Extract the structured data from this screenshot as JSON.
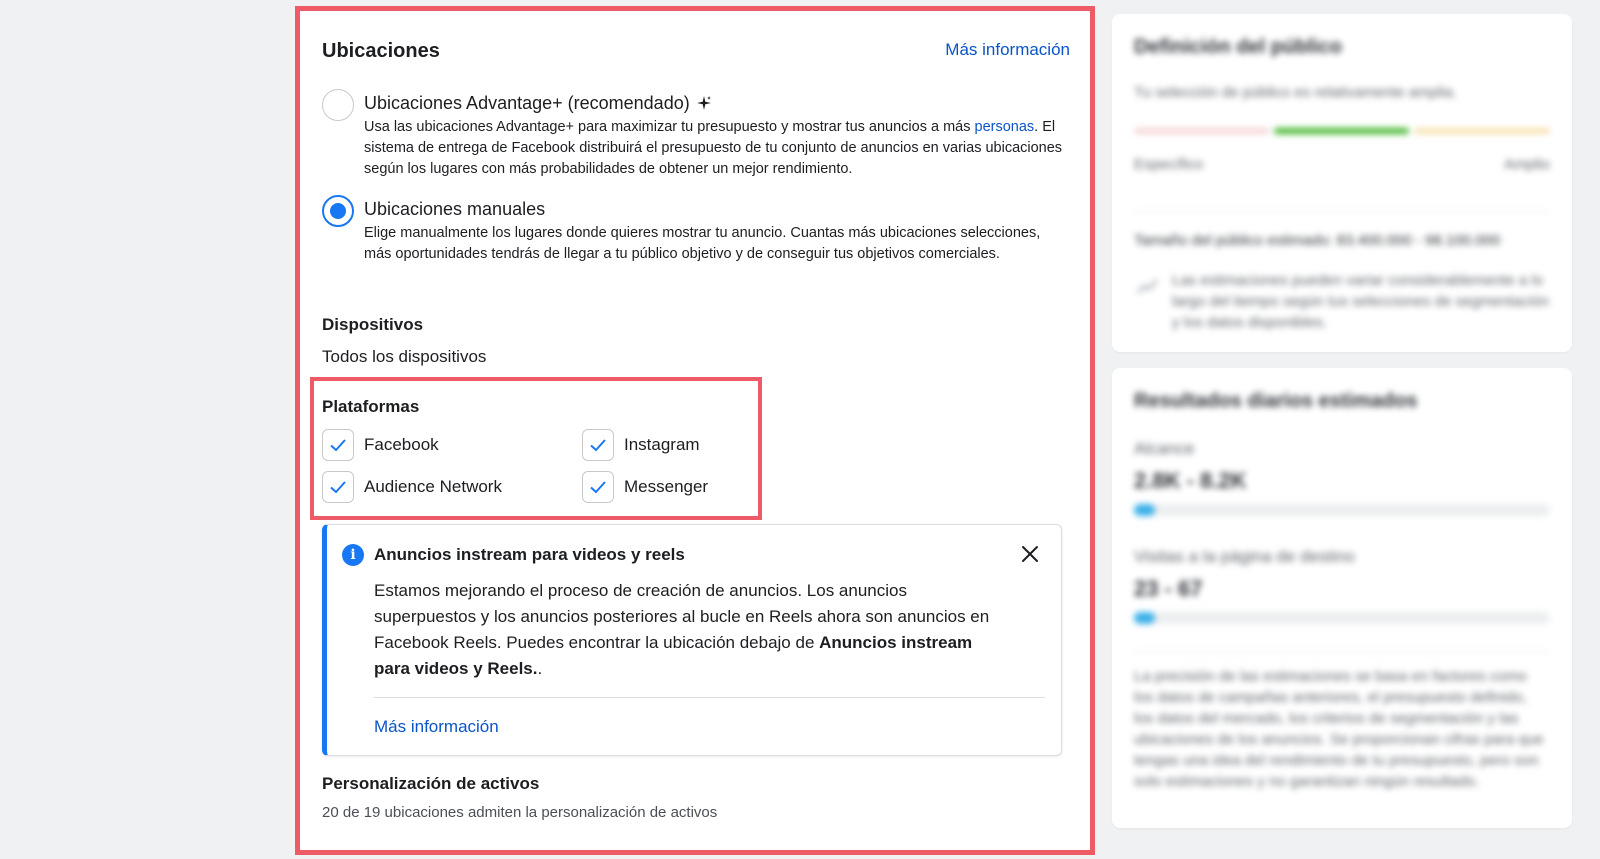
{
  "placements": {
    "title": "Ubicaciones",
    "more_info": "Más información",
    "advantage": {
      "title": "Ubicaciones Advantage+ (recomendado)",
      "desc_before_link": "Usa las ubicaciones Advantage+ para maximizar tu presupuesto y mostrar tus anuncios a más ",
      "desc_link": "personas",
      "desc_after_link": ". El sistema de entrega de Facebook distribuirá el presupuesto de tu conjunto de anuncios en varias ubicaciones según los lugares con más probabilidades de obtener un mejor rendimiento.",
      "selected": false
    },
    "manual": {
      "title": "Ubicaciones manuales",
      "desc": "Elige manualmente los lugares donde quieres mostrar tu anuncio. Cuantas más ubicaciones selecciones, más oportunidades tendrás de llegar a tu público objetivo y de conseguir tus objetivos comerciales.",
      "selected": true
    },
    "devices": {
      "label": "Dispositivos",
      "value": "Todos los dispositivos"
    },
    "platforms": {
      "label": "Plataformas",
      "items": [
        {
          "label": "Facebook",
          "checked": true
        },
        {
          "label": "Instagram",
          "checked": true
        },
        {
          "label": "Audience Network",
          "checked": true
        },
        {
          "label": "Messenger",
          "checked": true
        }
      ]
    },
    "notice": {
      "title": "Anuncios instream para videos y reels",
      "body": "Estamos mejorando el proceso de creación de anuncios. Los anuncios superpuestos y los anuncios posteriores al bucle en Reels ahora son anuncios en Facebook Reels. Puedes encontrar la ubicación debajo de ",
      "body_bold": "Anuncios instream para videos y Reels.",
      "body_end": ".",
      "link": "Más información"
    },
    "asset_customization": {
      "label": "Personalización de activos",
      "value": "20 de 19 ubicaciones admiten la personalización de activos"
    }
  },
  "audience_panel": {
    "title": "Definición del público",
    "subtitle": "Tu selección de público es relativamente amplia.",
    "specific": "Específico",
    "broad": "Amplio",
    "estimated_size": "Tamaño del público estimado: 83.400.000 - 98.100.000",
    "estimate_note": "Las estimaciones pueden variar considerablemente a lo largo del tiempo según tus selecciones de segmentación y los datos disponibles."
  },
  "results_panel": {
    "title": "Resultados diarios estimados",
    "reach_label": "Alcance",
    "reach_value": "2.8K - 8.2K",
    "reach_level": 0.05,
    "visits_label": "Visitas a la página de destino",
    "visits_value": "23 - 67",
    "visits_level": 0.05,
    "note": "La precisión de las estimaciones se basa en factores como los datos de campañas anteriores, el presupuesto definido, los datos del mercado, los criterios de segmentación y las ubicaciones de los anuncios. Se proporcionan cifras para que tengas una idea del rendimiento de tu presupuesto, pero son solo estimaciones y no garantizan ningún resultado."
  },
  "colors": {
    "accent": "#1877f2",
    "link": "#0a54c8",
    "highlight": "#ef5a67"
  }
}
